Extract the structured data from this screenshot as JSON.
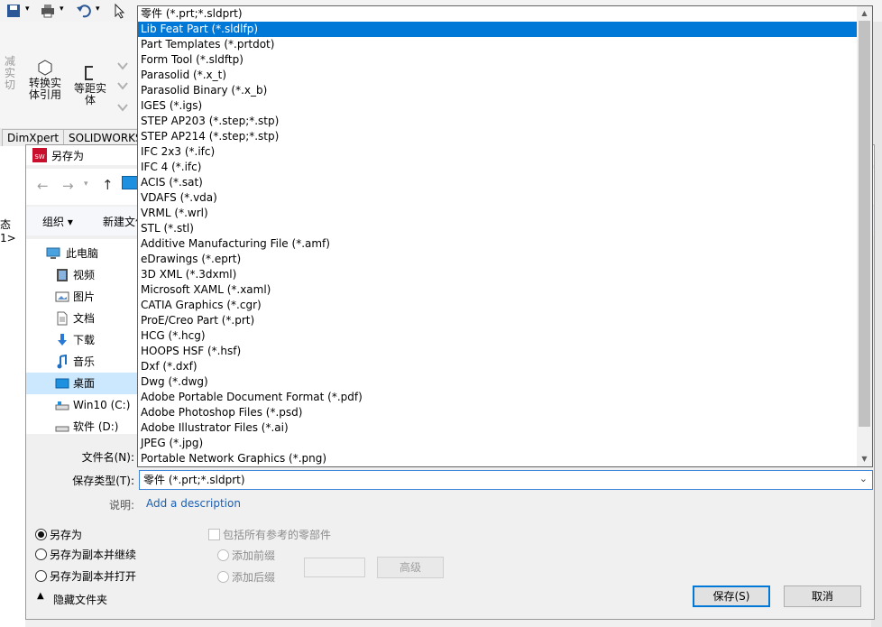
{
  "ribbon": {
    "left_partial": "减实\n切",
    "convert_entity": "转换实\n体引用",
    "offset_entity": "等距实\n体"
  },
  "tabs": [
    "DimXpert",
    "SOLIDWORKS插"
  ],
  "left_fragment": "态 1>",
  "dialog": {
    "title": "另存为",
    "organize": "组织 ▾",
    "new_folder": "新建文件夹",
    "nav_items": [
      {
        "label": "此电脑",
        "icon": "computer-icon"
      },
      {
        "label": "视频",
        "icon": "video-icon"
      },
      {
        "label": "图片",
        "icon": "pictures-icon"
      },
      {
        "label": "文档",
        "icon": "documents-icon"
      },
      {
        "label": "下载",
        "icon": "download-icon"
      },
      {
        "label": "音乐",
        "icon": "music-icon"
      },
      {
        "label": "桌面",
        "icon": "desktop-icon"
      },
      {
        "label": "Win10 (C:)",
        "icon": "drive-icon"
      },
      {
        "label": "软件 (D:)",
        "icon": "drive-icon"
      }
    ],
    "filename_label": "文件名(N):",
    "filetype_label": "保存类型(T):",
    "filetype_value": "零件 (*.prt;*.sldprt)",
    "description_label": "说明:",
    "description_link": "Add a description",
    "radio_save_as": "另存为",
    "radio_copy_continue": "另存为副本并继续",
    "radio_copy_open": "另存为副本并打开",
    "include_refs": "包括所有参考的零部件",
    "add_prefix": "添加前缀",
    "add_suffix": "添加后缀",
    "advanced": "高级",
    "hide_folders": "隐藏文件夹",
    "save": "保存(S)",
    "cancel": "取消"
  },
  "dropdown": {
    "selected_index": 1,
    "items": [
      "零件 (*.prt;*.sldprt)",
      "Lib Feat Part (*.sldlfp)",
      "Part Templates (*.prtdot)",
      "Form Tool (*.sldftp)",
      "Parasolid (*.x_t)",
      "Parasolid Binary (*.x_b)",
      "IGES (*.igs)",
      "STEP AP203 (*.step;*.stp)",
      "STEP AP214 (*.step;*.stp)",
      "IFC 2x3 (*.ifc)",
      "IFC 4 (*.ifc)",
      "ACIS (*.sat)",
      "VDAFS (*.vda)",
      "VRML (*.wrl)",
      "STL (*.stl)",
      "Additive Manufacturing File (*.amf)",
      "eDrawings (*.eprt)",
      "3D XML (*.3dxml)",
      "Microsoft XAML (*.xaml)",
      "CATIA Graphics (*.cgr)",
      "ProE/Creo Part (*.prt)",
      "HCG (*.hcg)",
      "HOOPS HSF (*.hsf)",
      "Dxf (*.dxf)",
      "Dwg (*.dwg)",
      "Adobe Portable Document Format (*.pdf)",
      "Adobe Photoshop Files (*.psd)",
      "Adobe Illustrator Files (*.ai)",
      "JPEG (*.jpg)",
      "Portable Network Graphics (*.png)"
    ]
  },
  "colors": {
    "selection": "#0078d7",
    "link": "#1a5fb4",
    "nav_selected": "#cce8ff"
  }
}
